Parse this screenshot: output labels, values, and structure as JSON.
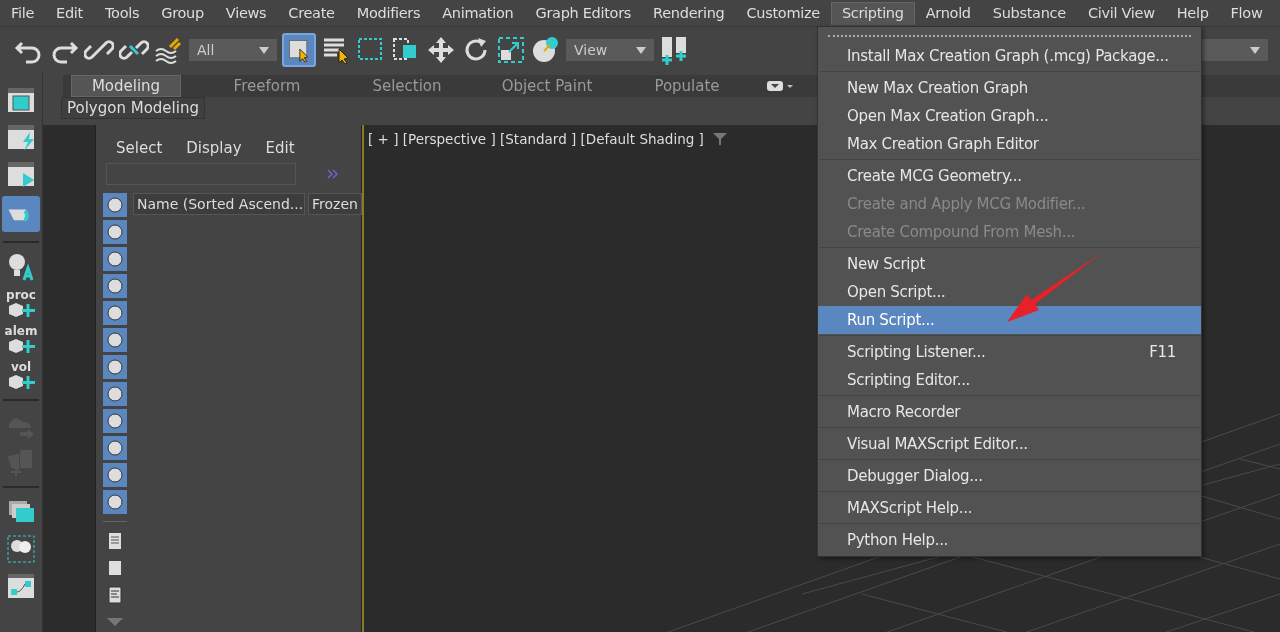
{
  "menu_bar": [
    {
      "label": "File",
      "selected": false
    },
    {
      "label": "Edit",
      "selected": false
    },
    {
      "label": "Tools",
      "selected": false
    },
    {
      "label": "Group",
      "selected": false
    },
    {
      "label": "Views",
      "selected": false
    },
    {
      "label": "Create",
      "selected": false
    },
    {
      "label": "Modifiers",
      "selected": false
    },
    {
      "label": "Animation",
      "selected": false
    },
    {
      "label": "Graph Editors",
      "selected": false
    },
    {
      "label": "Rendering",
      "selected": false
    },
    {
      "label": "Customize",
      "selected": false
    },
    {
      "label": "Scripting",
      "selected": true
    },
    {
      "label": "Arnold",
      "selected": false
    },
    {
      "label": "Substance",
      "selected": false
    },
    {
      "label": "Civil View",
      "selected": false
    },
    {
      "label": "Help",
      "selected": false
    },
    {
      "label": "Flow",
      "selected": false
    }
  ],
  "toolbar": {
    "selection_filter": "All",
    "reference_coordinate": "View"
  },
  "ribbon": {
    "tabs": [
      {
        "label": "Modeling",
        "selected": true
      },
      {
        "label": "Freeform",
        "selected": false
      },
      {
        "label": "Selection",
        "selected": false
      },
      {
        "label": "Object Paint",
        "selected": false
      },
      {
        "label": "Populate",
        "selected": false
      }
    ],
    "panel": "Polygon Modeling"
  },
  "sidebar": {
    "tools": [
      {
        "label": "proc"
      },
      {
        "label": "alem"
      },
      {
        "label": "vol"
      }
    ]
  },
  "scene_explorer": {
    "menu": [
      "Select",
      "Display",
      "Edit"
    ],
    "columns": [
      "Name (Sorted Ascend...",
      "Frozen"
    ],
    "filters": [
      {
        "on": true
      },
      {
        "on": true
      },
      {
        "on": true
      },
      {
        "on": true
      },
      {
        "on": true
      },
      {
        "on": true
      },
      {
        "on": true
      },
      {
        "on": true
      },
      {
        "on": true
      },
      {
        "on": true
      },
      {
        "on": true
      },
      {
        "on": true
      }
    ]
  },
  "viewport": {
    "label": "[ + ] [Perspective ] [Standard ] [Default Shading ]"
  },
  "scripting_menu": {
    "groups": [
      [
        {
          "label": "Install Max Creation Graph (.mcg) Package...",
          "disabled": false,
          "selected": false
        }
      ],
      [
        {
          "label": "New Max Creation Graph",
          "disabled": false,
          "selected": false
        },
        {
          "label": "Open Max Creation Graph...",
          "disabled": false,
          "selected": false
        },
        {
          "label": "Max Creation Graph Editor",
          "disabled": false,
          "selected": false
        }
      ],
      [
        {
          "label": "Create MCG Geometry...",
          "disabled": false,
          "selected": false
        },
        {
          "label": "Create and Apply MCG Modifier...",
          "disabled": true,
          "selected": false
        },
        {
          "label": "Create Compound From Mesh...",
          "disabled": true,
          "selected": false
        }
      ],
      [
        {
          "label": "New Script",
          "disabled": false,
          "selected": false
        },
        {
          "label": "Open Script...",
          "disabled": false,
          "selected": false
        },
        {
          "label": "Run Script...",
          "disabled": false,
          "selected": true
        }
      ],
      [
        {
          "label": "Scripting Listener...",
          "shortcut": "F11",
          "disabled": false,
          "selected": false
        },
        {
          "label": "Scripting Editor...",
          "disabled": false,
          "selected": false
        }
      ],
      [
        {
          "label": "Macro Recorder",
          "disabled": false,
          "selected": false
        }
      ],
      [
        {
          "label": "Visual MAXScript Editor...",
          "disabled": false,
          "selected": false
        }
      ],
      [
        {
          "label": "Debugger Dialog...",
          "disabled": false,
          "selected": false
        }
      ],
      [
        {
          "label": "MAXScript Help...",
          "disabled": false,
          "selected": false
        }
      ],
      [
        {
          "label": "Python Help...",
          "disabled": false,
          "selected": false
        }
      ]
    ]
  }
}
